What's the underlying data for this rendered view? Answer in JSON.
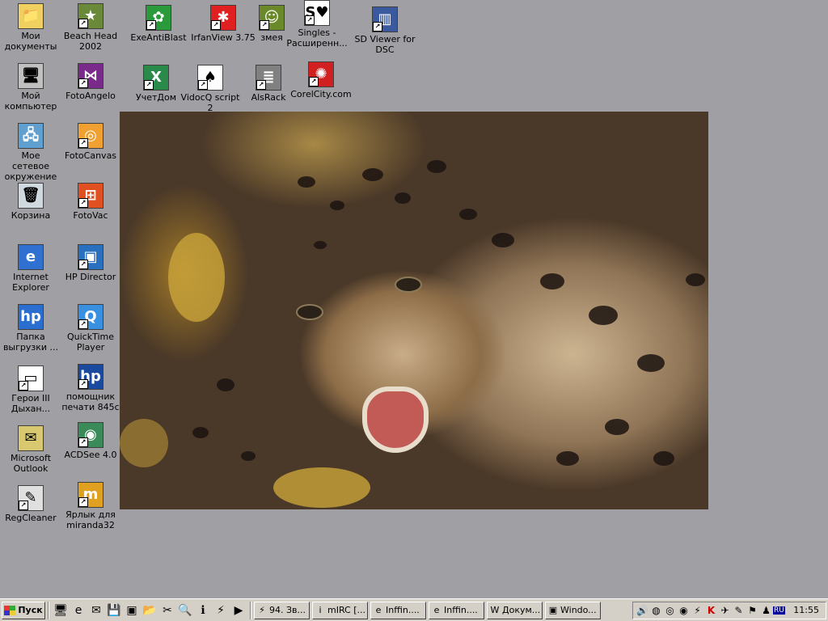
{
  "desktop_icons": [
    {
      "label": "Мои\nдокументы",
      "icon": "folder-documents-icon",
      "glyph": "📁",
      "color": "#f0d060",
      "shortcut": false
    },
    {
      "label": "Мой\nкомпьютер",
      "icon": "my-computer-icon",
      "glyph": "🖥",
      "color": "#c0c0c0",
      "shortcut": false
    },
    {
      "label": "Мое сетевое\nокружение",
      "icon": "network-icon",
      "glyph": "🖧",
      "color": "#60a0d0",
      "shortcut": false
    },
    {
      "label": "Корзина",
      "icon": "recycle-bin-icon",
      "glyph": "🗑",
      "color": "#d0d8e0",
      "shortcut": false
    },
    {
      "label": "Internet\nExplorer",
      "icon": "internet-explorer-icon",
      "glyph": "e",
      "color": "#3070d0",
      "shortcut": false
    },
    {
      "label": "Папка\nвыгрузки ...",
      "icon": "hp-folder-icon",
      "glyph": "hp",
      "color": "#2a6ed0",
      "shortcut": false
    },
    {
      "label": "Герои III\nДыхан...",
      "icon": "heroes-icon",
      "glyph": "▭",
      "color": "#ffffff",
      "shortcut": true
    },
    {
      "label": "Microsoft\nOutlook",
      "icon": "outlook-icon",
      "glyph": "✉",
      "color": "#d8c870",
      "shortcut": false
    },
    {
      "label": "RegCleaner",
      "icon": "regcleaner-icon",
      "glyph": "✎",
      "color": "#e0e0e0",
      "shortcut": true
    },
    {
      "label": "Beach Head\n2002",
      "icon": "beach-head-icon",
      "glyph": "★",
      "color": "#6a8a3a",
      "shortcut": true
    },
    {
      "label": "FotoAngelo",
      "icon": "fotoangelo-icon",
      "glyph": "⋈",
      "color": "#7a2a8a",
      "shortcut": true
    },
    {
      "label": "FotoCanvas",
      "icon": "fotocanvas-icon",
      "glyph": "◎",
      "color": "#f0a030",
      "shortcut": true
    },
    {
      "label": "FotoVac",
      "icon": "fotovac-icon",
      "glyph": "⊞",
      "color": "#e05020",
      "shortcut": true
    },
    {
      "label": "HP Director",
      "icon": "hp-director-icon",
      "glyph": "▣",
      "color": "#2a70c0",
      "shortcut": true
    },
    {
      "label": "QuickTime\nPlayer",
      "icon": "quicktime-icon",
      "glyph": "Q",
      "color": "#3a90e0",
      "shortcut": true
    },
    {
      "label": "помощник\nпечати 845c",
      "icon": "hp-print-icon",
      "glyph": "hp",
      "color": "#1a4aa0",
      "shortcut": true
    },
    {
      "label": "ACDSee 4.0",
      "icon": "acdsee-icon",
      "glyph": "◉",
      "color": "#3a8a5a",
      "shortcut": true
    },
    {
      "label": "Ярлык для\nmiranda32",
      "icon": "miranda-icon",
      "glyph": "m",
      "color": "#e0a020",
      "shortcut": true
    },
    {
      "label": "ExeAntiBlast",
      "icon": "exeantiblast-icon",
      "glyph": "✿",
      "color": "#2a9a3a",
      "shortcut": true
    },
    {
      "label": "IrfanView 3.75",
      "icon": "irfanview-icon",
      "glyph": "✱",
      "color": "#e02020",
      "shortcut": true
    },
    {
      "label": "змея",
      "icon": "snake-icon",
      "glyph": "☺",
      "color": "#6a8a2a",
      "shortcut": true
    },
    {
      "label": "Singles -\nРасширенн...",
      "icon": "singles-icon",
      "glyph": "S♥",
      "color": "#ffffff",
      "shortcut": true
    },
    {
      "label": "SD Viewer for\nDSC",
      "icon": "sd-viewer-icon",
      "glyph": "▥",
      "color": "#3a5aa0",
      "shortcut": true
    },
    {
      "label": "УчетДом",
      "icon": "uchetdom-icon",
      "glyph": "X",
      "color": "#2a8a4a",
      "shortcut": true
    },
    {
      "label": "VidocQ script 2",
      "icon": "vidocq-icon",
      "glyph": "♠",
      "color": "#ffffff",
      "shortcut": true
    },
    {
      "label": "AlsRack",
      "icon": "alsrack-icon",
      "glyph": "≣",
      "color": "#808080",
      "shortcut": true
    },
    {
      "label": "CorelCity.com",
      "icon": "corelcity-icon",
      "glyph": "✺",
      "color": "#d02020",
      "shortcut": true
    }
  ],
  "taskbar": {
    "start_label": "Пуск",
    "quick_launch": [
      {
        "icon": "show-desktop-icon",
        "glyph": "🖥"
      },
      {
        "icon": "ie-quick-icon",
        "glyph": "e"
      },
      {
        "icon": "outlook-quick-icon",
        "glyph": "✉"
      },
      {
        "icon": "save-quick-icon",
        "glyph": "💾"
      },
      {
        "icon": "app-quick-icon",
        "glyph": "▣"
      },
      {
        "icon": "folder-quick-icon",
        "glyph": "📂"
      },
      {
        "icon": "tool-quick-icon",
        "glyph": "✂"
      },
      {
        "icon": "search-quick-icon",
        "glyph": "🔍"
      },
      {
        "icon": "info-quick-icon",
        "glyph": "ℹ"
      },
      {
        "icon": "winamp-quick-icon",
        "glyph": "⚡"
      },
      {
        "icon": "media-quick-icon",
        "glyph": "▶"
      }
    ],
    "tasks": [
      {
        "label": "94. Зв...",
        "icon": "winamp-task-icon",
        "glyph": "⚡",
        "active": false
      },
      {
        "label": "mIRC [...",
        "icon": "mirc-task-icon",
        "glyph": "i",
        "active": false
      },
      {
        "label": "Inffin....",
        "icon": "ie-task-icon",
        "glyph": "e",
        "active": false
      },
      {
        "label": "Inffin....",
        "icon": "ie-task-icon-2",
        "glyph": "e",
        "active": false
      },
      {
        "label": "Докум...",
        "icon": "word-task-icon",
        "glyph": "W",
        "active": false
      },
      {
        "label": "Windo...",
        "icon": "window-task-icon",
        "glyph": "▣",
        "active": false
      }
    ],
    "tray": [
      {
        "icon": "volume-icon",
        "glyph": "🔊"
      },
      {
        "icon": "network-tray-icon",
        "glyph": "◍"
      },
      {
        "icon": "cd-tray-icon",
        "glyph": "◎"
      },
      {
        "icon": "tray-app-icon",
        "glyph": "◉"
      },
      {
        "icon": "winamp-tray-icon",
        "glyph": "⚡"
      },
      {
        "icon": "kaspersky-icon",
        "glyph": "K"
      },
      {
        "icon": "tray-tool-icon",
        "glyph": "✈"
      },
      {
        "icon": "tray-pen-icon",
        "glyph": "✎"
      },
      {
        "icon": "tray-flag-icon",
        "glyph": "⚑"
      },
      {
        "icon": "tray-user-icon",
        "glyph": "♟"
      }
    ],
    "language": "RU",
    "clock": "11:55"
  }
}
